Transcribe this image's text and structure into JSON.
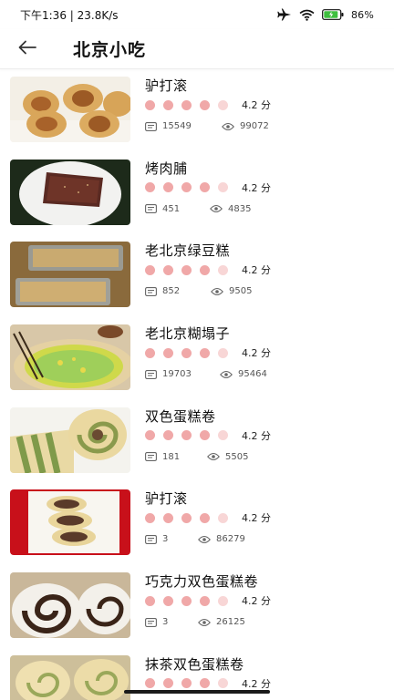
{
  "status_bar": {
    "time": "下午1:36 | 23.8K/s",
    "battery": "86%",
    "icons": [
      "airplane-icon",
      "wifi-icon",
      "battery-icon"
    ]
  },
  "header": {
    "title": "北京小吃",
    "back_icon": "back-arrow-icon"
  },
  "colors": {
    "rating_dot": "#f0a8a8",
    "rating_dot_empty": "#f8d6d6"
  },
  "items": [
    {
      "name": "驴打滚",
      "score": "4.2 分",
      "rating": 4.2,
      "comments": "15549",
      "views": "99072"
    },
    {
      "name": "烤肉脯",
      "score": "4.2 分",
      "rating": 4.2,
      "comments": "451",
      "views": "4835"
    },
    {
      "name": "老北京绿豆糕",
      "score": "4.2 分",
      "rating": 4.2,
      "comments": "852",
      "views": "9505"
    },
    {
      "name": "老北京糊塌子",
      "score": "4.2 分",
      "rating": 4.2,
      "comments": "19703",
      "views": "95464"
    },
    {
      "name": "双色蛋糕卷",
      "score": "4.2 分",
      "rating": 4.2,
      "comments": "181",
      "views": "5505"
    },
    {
      "name": "驴打滚",
      "score": "4.2 分",
      "rating": 4.2,
      "comments": "3",
      "views": "86279"
    },
    {
      "name": "巧克力双色蛋糕卷",
      "score": "4.2 分",
      "rating": 4.2,
      "comments": "3",
      "views": "26125"
    },
    {
      "name": "抹茶双色蛋糕卷",
      "score": "4.2 分",
      "rating": 4.2,
      "comments": "",
      "views": ""
    }
  ]
}
